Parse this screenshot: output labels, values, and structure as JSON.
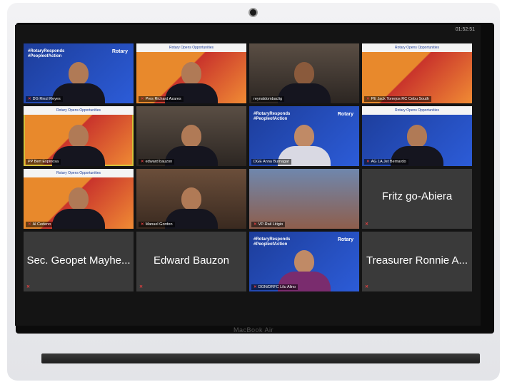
{
  "device": {
    "brand_label": "MacBook Air"
  },
  "meeting": {
    "clock": "01:52:51"
  },
  "rotary": {
    "hashtag_1": "#RotaryResponds",
    "hashtag_2": "#PeopleofAction",
    "logo": "Rotary",
    "opportunities": "Rotary Opens Opportunities"
  },
  "participants": [
    {
      "name": "DG Riezl Reyes"
    },
    {
      "name": "Pres Richard Azares"
    },
    {
      "name": "reynaldombaclig"
    },
    {
      "name": "PE Jack Torrejos RC Cebu South"
    },
    {
      "name": "PP Bert Espinosa"
    },
    {
      "name": "edward bauzon"
    },
    {
      "name": "DGE Anna Bumagat"
    },
    {
      "name": "AG 1A Jet Bernardo"
    },
    {
      "name": "Al Cedeno"
    },
    {
      "name": "Manuel Gordon"
    },
    {
      "name": "VP-Rail Litigio"
    },
    {
      "name": "Fritz go-Abiera"
    },
    {
      "name": "Sec. Geopet Mayhe..."
    },
    {
      "name": "Edward Bauzon"
    },
    {
      "name": "DGN/DRFC Lilu Alino"
    },
    {
      "name": "Treasurer Ronnie A..."
    }
  ],
  "colors": {
    "mic_muted": "#e04040",
    "active_speaker": "#d6c13a"
  },
  "icons": {
    "mic": "muted-mic-icon"
  }
}
